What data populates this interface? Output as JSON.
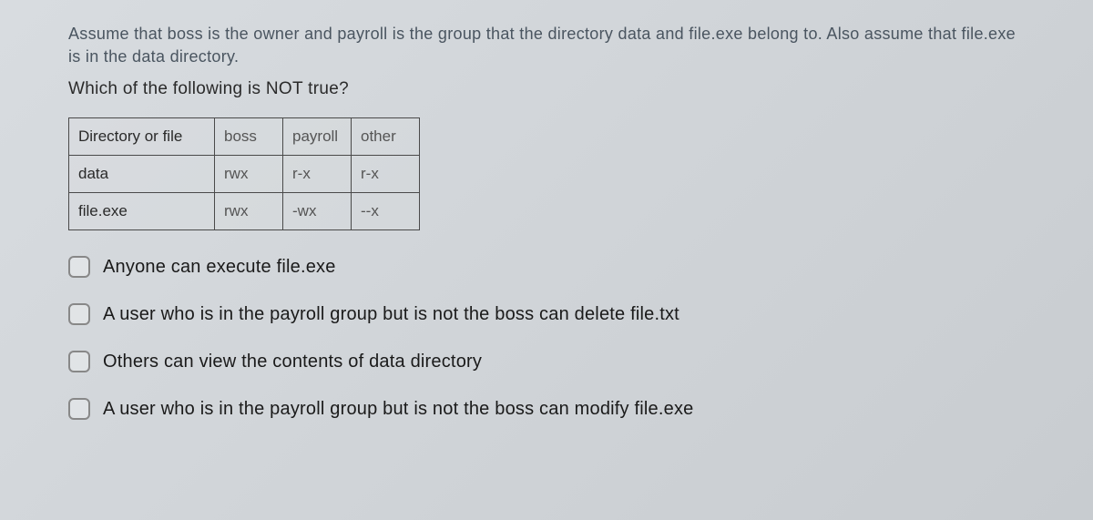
{
  "question": {
    "intro": "Assume that boss is the owner and payroll is the group that the directory data and file.exe belong to. Also assume that file.exe is in the data directory.",
    "main": "Which of the following is NOT true?"
  },
  "table": {
    "headers": [
      "Directory or file",
      "boss",
      "payroll",
      "other"
    ],
    "rows": [
      {
        "name": "data",
        "boss": "rwx",
        "payroll": "r-x",
        "other": "r-x"
      },
      {
        "name": "file.exe",
        "boss": "rwx",
        "payroll": "-wx",
        "other": "--x"
      }
    ]
  },
  "options": [
    {
      "text": "Anyone can execute  file.exe"
    },
    {
      "text": "A user who is in the payroll group but is not the boss can  delete file.txt"
    },
    {
      "text": "Others can view the contents of data directory"
    },
    {
      "text": "A user who is in the payroll group but is not the boss can modify file.exe"
    }
  ]
}
